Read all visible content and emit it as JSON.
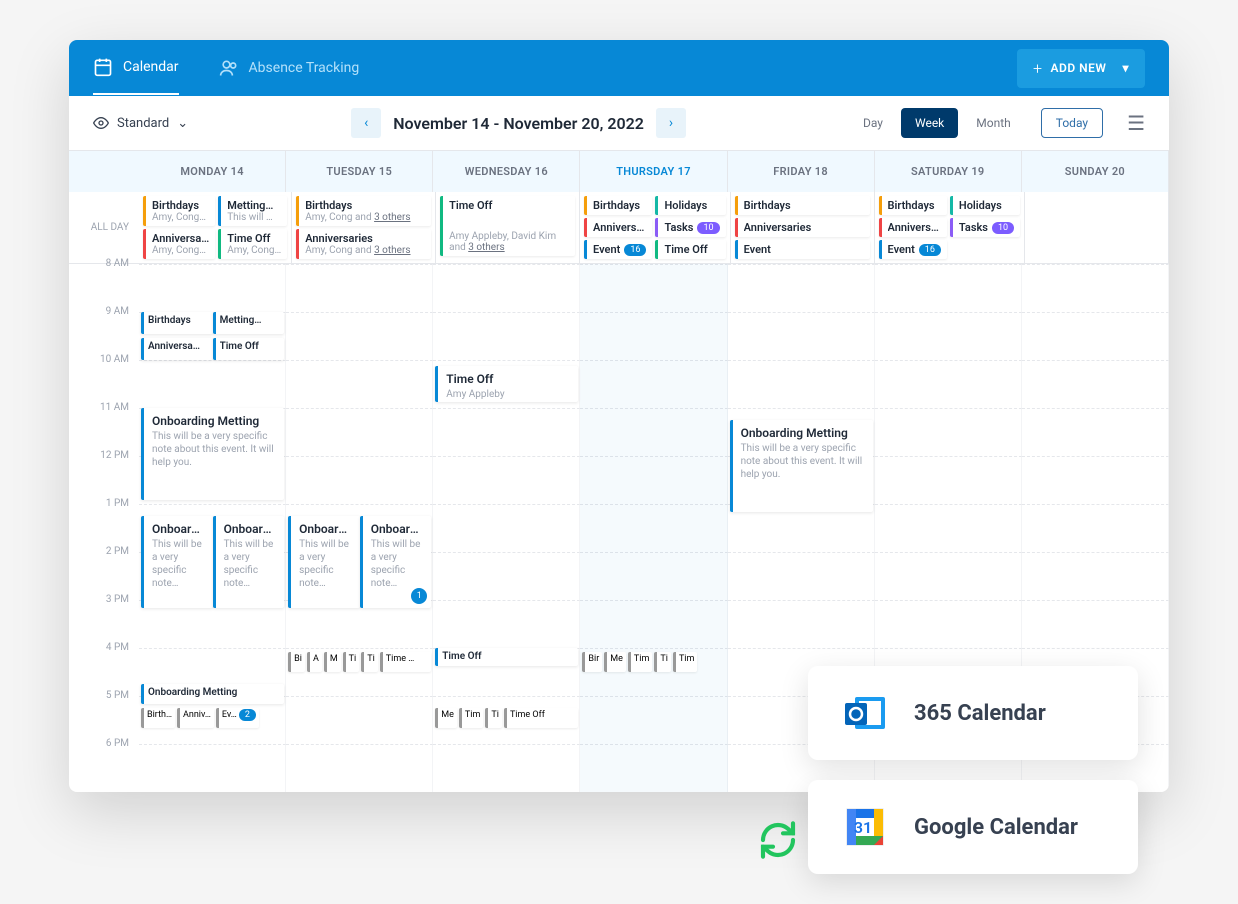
{
  "header": {
    "tabs": [
      {
        "id": "calendar",
        "label": "Calendar",
        "active": true
      },
      {
        "id": "absence",
        "label": "Absence Tracking",
        "active": false
      }
    ],
    "add_new_label": "ADD NEW"
  },
  "toolbar": {
    "view_mode_label": "Standard",
    "date_range": "November 14 - November 20, 2022",
    "views": [
      {
        "id": "day",
        "label": "Day"
      },
      {
        "id": "week",
        "label": "Week",
        "active": true
      },
      {
        "id": "month",
        "label": "Month"
      }
    ],
    "today_label": "Today"
  },
  "days": [
    {
      "id": "mon",
      "label": "MONDAY 14"
    },
    {
      "id": "tue",
      "label": "TUESDAY 15"
    },
    {
      "id": "wed",
      "label": "WEDNESDAY 16"
    },
    {
      "id": "thu",
      "label": "THURSDAY 17",
      "active": true
    },
    {
      "id": "fri",
      "label": "FRIDAY 18"
    },
    {
      "id": "sat",
      "label": "SATURDAY 19"
    },
    {
      "id": "sun",
      "label": "SUNDAY 20"
    }
  ],
  "gutter": {
    "all_day": "ALL DAY",
    "hours": [
      "8 AM",
      "9 AM",
      "10 AM",
      "11 AM",
      "12 PM",
      "1 PM",
      "2 PM",
      "3 PM",
      "4 PM",
      "5 PM",
      "6 PM"
    ]
  },
  "all_day_events": {
    "mon": {
      "col1": [
        {
          "title": "Birthdays",
          "sub": "Amy, Cong…",
          "color": "orange"
        },
        {
          "title": "Anniversa…",
          "sub": "Amy, Cong…",
          "color": "red"
        }
      ],
      "col2": [
        {
          "title": "Metting…",
          "sub": "This will …",
          "color": "blue"
        },
        {
          "title": "Time Off",
          "sub": "Amy, Cong…",
          "color": "green"
        }
      ]
    },
    "tue": [
      {
        "title": "Birthdays",
        "sub": "Amy, Cong and ",
        "link": "3 others",
        "color": "orange"
      },
      {
        "title": "Anniversaries",
        "sub": "Amy, Cong and ",
        "link": "3 others",
        "color": "red"
      }
    ],
    "wed_single": {
      "title": "Time Off",
      "sub": "Amy Appleby, David Kim and ",
      "link": "3 others",
      "color": "green"
    },
    "thu": {
      "col1": [
        {
          "title": "Birthdays",
          "color": "orange"
        },
        {
          "title": "Annivers…",
          "color": "red"
        },
        {
          "title": "Event",
          "badge": "16",
          "color": "blue"
        }
      ],
      "col2": [
        {
          "title": "Holidays",
          "color": "teal"
        },
        {
          "title": "Tasks",
          "badge": "10",
          "badgeColor": "purple",
          "color": "purple"
        },
        {
          "title": "Time Off",
          "color": "green"
        }
      ]
    },
    "fri": [
      {
        "title": "Birthdays",
        "color": "orange"
      },
      {
        "title": "Anniversaries",
        "color": "red"
      },
      {
        "title": "Event",
        "color": "blue"
      }
    ],
    "sat": {
      "col1": [
        {
          "title": "Birthdays",
          "color": "orange"
        },
        {
          "title": "Annivers…",
          "color": "red"
        },
        {
          "title": "Event",
          "badge": "16",
          "color": "blue"
        }
      ],
      "col2": [
        {
          "title": "Holidays",
          "color": "teal"
        },
        {
          "title": "Tasks",
          "badge": "10",
          "badgeColor": "purple",
          "color": "purple"
        }
      ]
    }
  },
  "timed_events": {
    "mon": {
      "row_9am": {
        "col1": {
          "title": "Birthdays",
          "color": "orange"
        },
        "col2": {
          "title": "Metting…",
          "color": "blue"
        }
      },
      "row_945": {
        "col1": {
          "title": "Anniversa…",
          "color": "red"
        },
        "col2": {
          "title": "Time Off",
          "color": "green"
        }
      },
      "onboarding": {
        "title": "Onboarding Metting",
        "desc": "This will be a very specific note about this event. It will help you."
      },
      "split4": [
        {
          "title": "Onboard…",
          "desc": "This will be a very specific note…"
        },
        {
          "title": "Onboard…",
          "desc": "This will be a very specific note…"
        }
      ],
      "row_5pm": {
        "title": "Onboarding Metting"
      },
      "row_5pm_chips": [
        {
          "title": "Birth…",
          "color": "orange"
        },
        {
          "title": "Anniv…",
          "color": "red"
        },
        {
          "title": "Ev…",
          "badge": "2",
          "color": "blue"
        }
      ]
    },
    "tue": {
      "split4": [
        {
          "title": "Onboard…",
          "desc": "This will be a very specific note…"
        },
        {
          "title": "Onboard…",
          "desc": "This will be a very specific note…",
          "badge": "1"
        }
      ],
      "row_4pm_chips": [
        {
          "title": "Bi",
          "color": "orange"
        },
        {
          "title": "A",
          "color": "red"
        },
        {
          "title": "M",
          "color": "blue"
        },
        {
          "title": "Ti",
          "color": "green"
        },
        {
          "title": "Ti",
          "color": "purple"
        },
        {
          "title": "Time …",
          "color": "green"
        }
      ]
    },
    "wed": {
      "timeoff": {
        "title": "Time Off",
        "sub": "Amy Appleby",
        "color": "green"
      },
      "row_4pm": {
        "title": "Time Off",
        "color": "green"
      },
      "row_5pm_chips": [
        {
          "title": "Me",
          "color": "blue"
        },
        {
          "title": "Tim",
          "color": "green"
        },
        {
          "title": "Ti",
          "color": "purple"
        },
        {
          "title": "Time Off",
          "color": "green"
        }
      ]
    },
    "thu": {
      "row_4pm_chips": [
        {
          "title": "Bir",
          "color": "orange"
        },
        {
          "title": "Me",
          "color": "blue"
        },
        {
          "title": "Tim",
          "color": "green"
        },
        {
          "title": "Ti",
          "color": "purple"
        },
        {
          "title": "Tim",
          "color": "green"
        }
      ]
    },
    "fri": {
      "onboarding": {
        "title": "Onboarding Metting",
        "desc": "This will be a very specific note about this event. It will help you."
      }
    }
  },
  "integrations": [
    {
      "id": "outlook",
      "label": "365 Calendar"
    },
    {
      "id": "google",
      "label": "Google Calendar"
    }
  ]
}
